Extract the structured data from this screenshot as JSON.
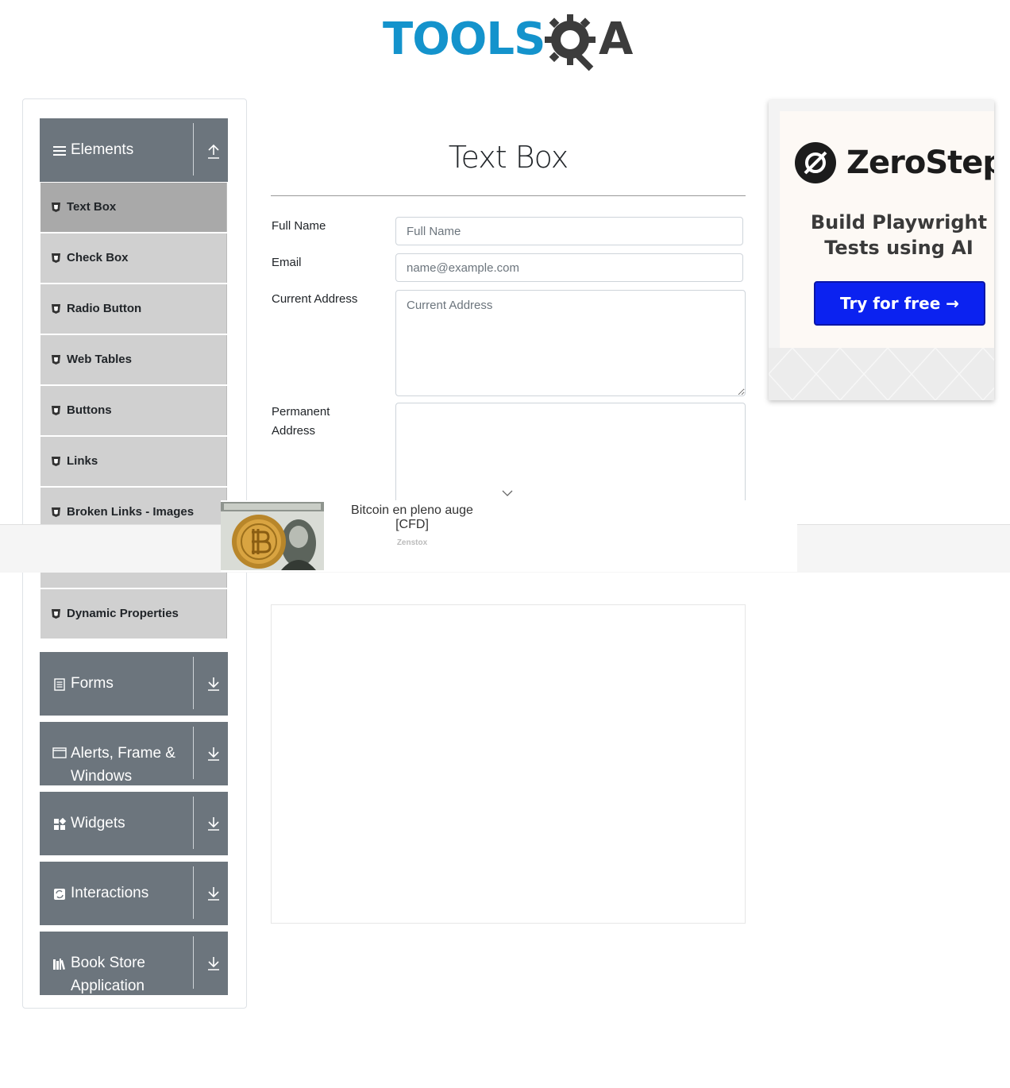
{
  "logo": {
    "text_tools": "TOOLS",
    "text_a": "A"
  },
  "sidebar": {
    "groups": [
      {
        "label": "Elements",
        "icon": "hamburger-icon",
        "state": "expanded"
      },
      {
        "label": "Forms",
        "icon": "form-icon",
        "state": "collapsed"
      },
      {
        "label": "Alerts, Frame &",
        "label2": "Windows",
        "icon": "window-icon",
        "state": "collapsed"
      },
      {
        "label": "Widgets",
        "icon": "widgets-icon",
        "state": "collapsed"
      },
      {
        "label": "Interactions",
        "icon": "interactions-icon",
        "state": "collapsed"
      },
      {
        "label": "Book Store",
        "label2": "Application",
        "icon": "books-icon",
        "state": "collapsed"
      }
    ],
    "items": [
      {
        "label": "Text Box",
        "active": true
      },
      {
        "label": "Check Box"
      },
      {
        "label": "Radio Button"
      },
      {
        "label": "Web Tables"
      },
      {
        "label": "Buttons"
      },
      {
        "label": "Links"
      },
      {
        "label": "Broken Links - Images"
      },
      {
        "label": "Dynamic Properties"
      }
    ]
  },
  "main": {
    "title": "Text Box",
    "fields": {
      "full_name": {
        "label": "Full Name",
        "placeholder": "Full Name",
        "value": ""
      },
      "email": {
        "label": "Email",
        "placeholder": "name@example.com",
        "value": ""
      },
      "current_address": {
        "label": "Current Address",
        "placeholder": "Current Address",
        "value": ""
      },
      "permanent_address": {
        "label1": "Permanent",
        "label2": "Address",
        "placeholder": "",
        "value": ""
      }
    }
  },
  "right_ad": {
    "brand": "ZeroStep",
    "tagline1": "Build Playwright",
    "tagline2": "Tests using AI",
    "cta": "Try for free →",
    "cta_color": "#0b22f0"
  },
  "bottom_ad": {
    "title1": "Bitcoin en pleno auge",
    "title2": "[CFD]",
    "source": "Zenstox"
  },
  "colors": {
    "sidebar_header": "#6c757d",
    "menu_item": "#d0d0d0",
    "menu_active": "#a9a9a9",
    "logo_blue": "#1493cc"
  }
}
